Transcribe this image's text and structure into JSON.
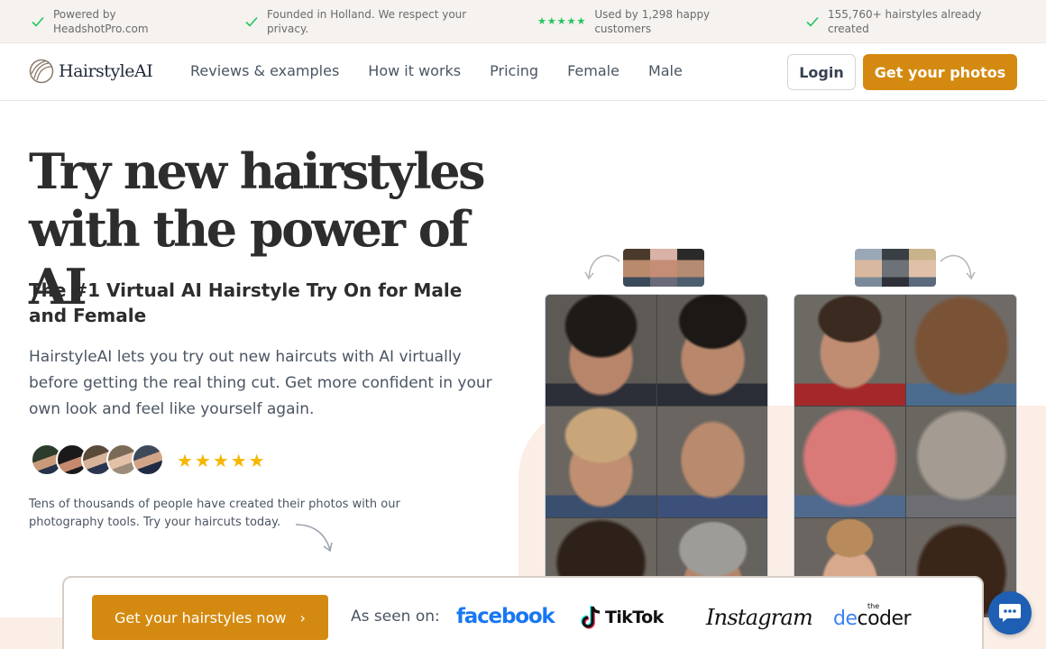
{
  "topbar": {
    "items": [
      {
        "label": "Powered by HeadshotPro.com",
        "icon": "check-icon"
      },
      {
        "label": "Founded in Holland. We respect your privacy.",
        "icon": "check-icon"
      },
      {
        "label": "Used by 1,298 happy customers",
        "icon": "star-rating",
        "stars": "★★★★★"
      },
      {
        "label": "155,760+ hairstyles already created",
        "icon": "check-icon"
      }
    ]
  },
  "nav": {
    "logo_text": "HairstyleAI",
    "links": [
      "Reviews & examples",
      "How it works",
      "Pricing",
      "Female",
      "Male"
    ],
    "login": "Login",
    "cta": "Get your photos"
  },
  "hero": {
    "title_line1": "Try new hairstyles",
    "title_line2": "with the power of AI",
    "subtitle": "The #1 Virtual AI Hairstyle Try On for Male and Female",
    "description": "HairstyleAI lets you try out new haircuts with AI virtually before getting the real thing cut. Get more confident in your own look and feel like yourself again.",
    "rating": 5,
    "rating_stars": "★★★★★",
    "social_note": "Tens of thousands of people have created their photos with our photography tools. Try your haircuts today."
  },
  "bottom": {
    "cta": "Get your hairstyles now",
    "cta_chevron": "›",
    "seen_on": "As seen on:",
    "brands": {
      "facebook": "facebook",
      "tiktok": "TikTok",
      "instagram": "Instagram",
      "decoder_small": "the",
      "decoder_a": "de",
      "decoder_b": "coder"
    }
  },
  "colors": {
    "accent": "#d48a10",
    "check": "#22c55e",
    "peach": "#fbeee7",
    "star": "#f5b700"
  }
}
